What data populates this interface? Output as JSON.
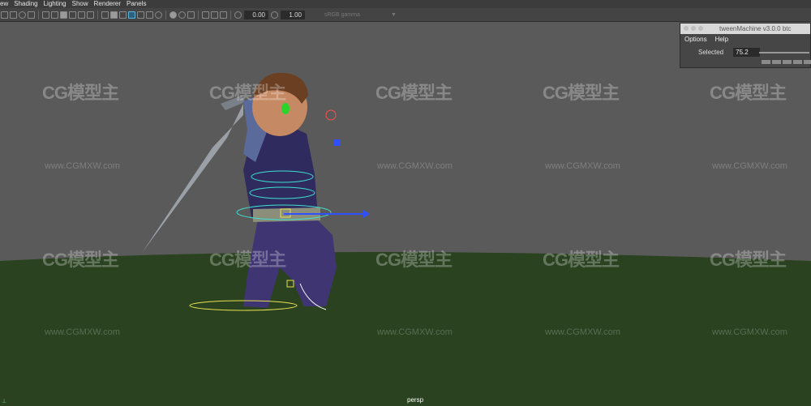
{
  "menu": [
    "ew",
    "Shading",
    "Lighting",
    "Show",
    "Renderer",
    "Panels"
  ],
  "toolbar": {
    "field_1": "0.00",
    "field_2": "1.00",
    "colorspace": "sRGB gamma"
  },
  "viewport": {
    "camera_label": "persp",
    "watermark_logo": "CG模型主",
    "watermark_url": "www.CGMXW.com",
    "sky_color": "#5a5a5a",
    "ground_color": "#2a4220"
  },
  "tween_machine": {
    "title": "tweenMachine v3.0.0 btc",
    "menu": [
      "Options",
      "Help"
    ],
    "selected_label": "Selected",
    "selected_value": "75.2"
  }
}
